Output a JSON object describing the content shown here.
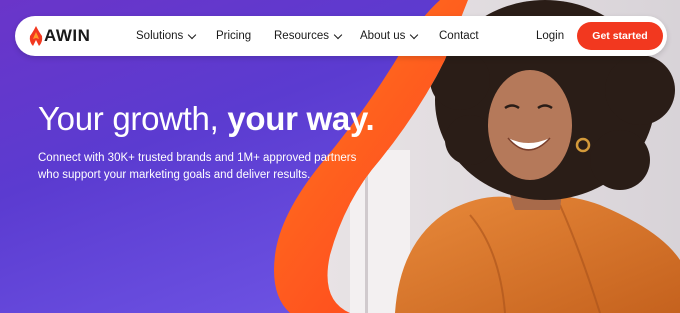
{
  "brand": {
    "logo_text": "AWIN"
  },
  "nav": {
    "items": [
      {
        "label": "Solutions",
        "has_dropdown": true
      },
      {
        "label": "Pricing",
        "has_dropdown": false
      },
      {
        "label": "Resources",
        "has_dropdown": true
      },
      {
        "label": "About us",
        "has_dropdown": true
      },
      {
        "label": "Contact",
        "has_dropdown": false
      }
    ],
    "login_label": "Login",
    "cta_label": "Get started"
  },
  "hero": {
    "title_regular": "Your growth, ",
    "title_bold": "your way.",
    "subtitle": "Connect with 30K+ trusted brands and 1M+ approved partners who support your marketing goals and deliver results."
  },
  "colors": {
    "background_purple": "#6a35c9",
    "accent_orange": "#ff5a1f",
    "cta_red": "#f2381f"
  },
  "icons": {
    "logo_mark": "flame-icon",
    "dropdown": "chevron-down-icon"
  }
}
